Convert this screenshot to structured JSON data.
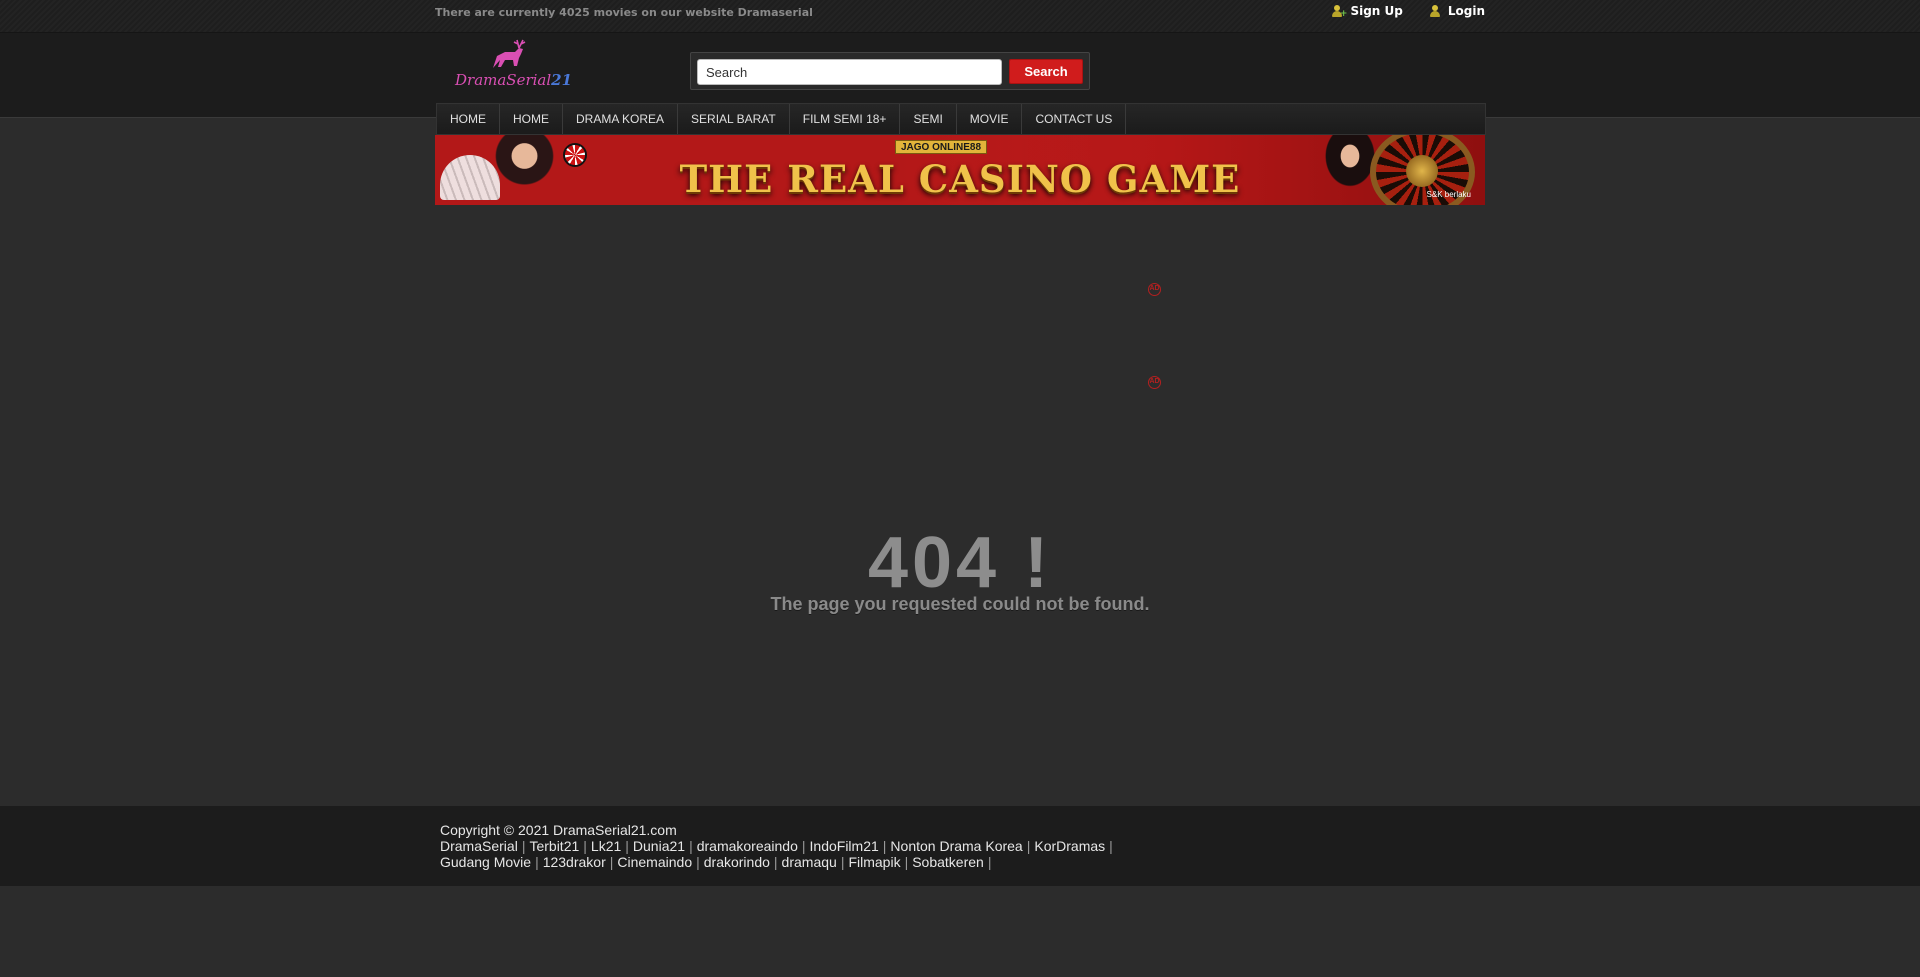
{
  "topbar": {
    "notice": "There are currently 4025 movies on our website Dramaserial",
    "signup_label": "Sign Up",
    "login_label": "Login"
  },
  "header": {
    "logo_text": "DramaSerial",
    "logo_number": "21",
    "search": {
      "placeholder": "Search",
      "value": "Search",
      "button_label": "Search"
    }
  },
  "nav": {
    "items": [
      "HOME",
      "HOME",
      "DRAMA KOREA",
      "SERIAL BARAT",
      "FILM SEMI 18+",
      "SEMI",
      "MOVIE",
      "CONTACT US"
    ]
  },
  "banner": {
    "brand": "JAGO ONLINE88",
    "headline": "THE REAL CASINO GAME",
    "terms": "S&K berlaku"
  },
  "ad_icons": [
    "ad-choices-icon",
    "ad-choices-icon"
  ],
  "error": {
    "code": "404 !",
    "message": "The page you requested could not be found."
  },
  "footer": {
    "copyright": "Copyright © 2021 DramaSerial21.com",
    "links_row1": [
      "DramaSerial",
      "Terbit21",
      "Lk21",
      "Dunia21",
      "dramakoreaindo",
      "IndoFilm21",
      "Nonton Drama Korea",
      "KorDramas"
    ],
    "links_row2": [
      "Gudang Movie",
      "123drakor",
      "Cinemaindo",
      "drakorindo",
      "dramaqu",
      "Filmapik",
      "Sobatkeren"
    ]
  },
  "colors": {
    "background": "#2c2c2c",
    "header_bg": "#1c1c1c",
    "search_button": "#d01c1c",
    "banner_red": "#c71f1f",
    "banner_gold": "#f0c24a",
    "error_text": "#8d8d8d"
  }
}
